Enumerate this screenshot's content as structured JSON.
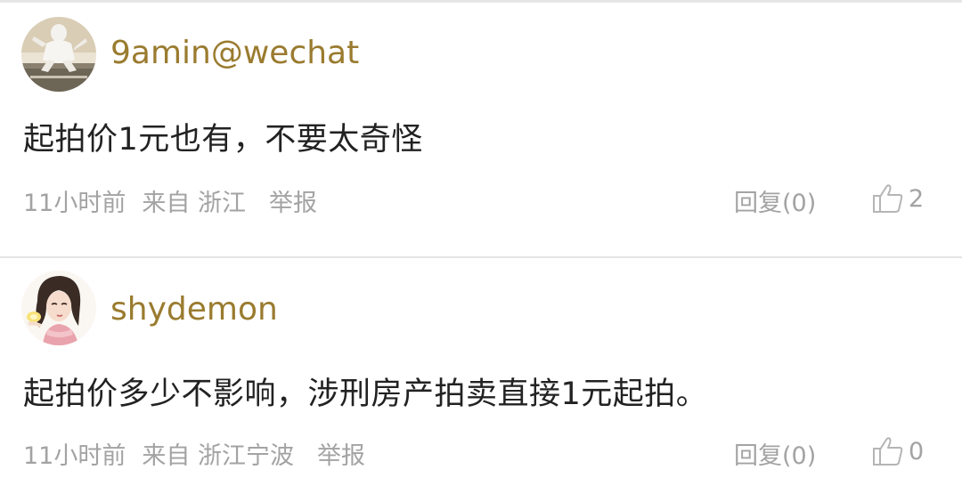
{
  "comments": [
    {
      "username": "9amin@wechat",
      "avatar": "sculpture-figure-avatar",
      "text": "起拍价1元也有，不要太奇怪",
      "time": "11小时前",
      "location": "来自 浙江",
      "report_label": "举报",
      "reply_label": "回复(0)",
      "like_icon": "thumbs-up-icon",
      "like_count": "2"
    },
    {
      "username": "shydemon",
      "avatar": "illustrated-girl-avatar",
      "text": "起拍价多少不影响，涉刑房产拍卖直接1元起拍。",
      "time": "11小时前",
      "location": "来自 浙江宁波",
      "report_label": "举报",
      "reply_label": "回复(0)",
      "like_icon": "thumbs-up-icon",
      "like_count": "0"
    }
  ],
  "colors": {
    "username": "#9a7b2f",
    "text": "#222222",
    "meta": "#a3a3a3",
    "divider": "#e4e4e4"
  }
}
